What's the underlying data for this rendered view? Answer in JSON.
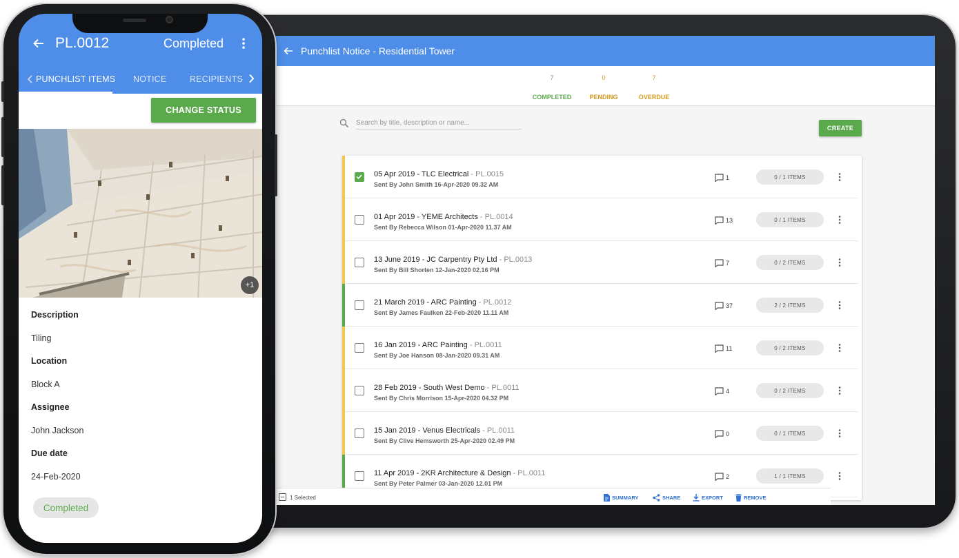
{
  "tablet": {
    "title": "Punchlist Notice - Residential Tower",
    "stats": [
      {
        "count": "7",
        "label": "COMPLETED"
      },
      {
        "count": "0",
        "label": "PENDING"
      },
      {
        "count": "7",
        "label": "OVERDUE"
      }
    ],
    "search_placeholder": "Search by title, description or name...",
    "create_label": "CREATE",
    "rows": [
      {
        "title": "05 Apr 2019 - TLC Electrical",
        "code": " - PL.0015",
        "sent": "Sent By John Smith 16-Apr-2020 09.32 AM",
        "comments": "1",
        "items": "0 / 1 ITEMS",
        "status_color": "#f2c94c",
        "checked": true
      },
      {
        "title": "01 Apr 2019 - YEME Architects",
        "code": " - PL.0014",
        "sent": "Sent By Rebecca Wilson 01-Apr-2020 11.37 AM",
        "comments": "13",
        "items": "0 / 1 ITEMS",
        "status_color": "#f2c94c",
        "checked": false
      },
      {
        "title": "13 June 2019 - JC Carpentry Pty Ltd",
        "code": " - PL.0013",
        "sent": "Sent By Bill Shorten 12-Jan-2020 02.16 PM",
        "comments": "7",
        "items": "0 / 2 ITEMS",
        "status_color": "#f2c94c",
        "checked": false
      },
      {
        "title": "21 March 2019 - ARC Painting",
        "code": " - PL.0012",
        "sent": "Sent By James Faulken 22-Feb-2020 11.11 AM",
        "comments": "37",
        "items": "2 / 2 ITEMS",
        "status_color": "#5aaa4b",
        "checked": false
      },
      {
        "title": "16 Jan 2019 - ARC Painting",
        "code": " - PL.0011",
        "sent": "Sent By Joe Hanson 08-Jan-2020 09.31 AM",
        "comments": "11",
        "items": "0 / 2 ITEMS",
        "status_color": "#f2c94c",
        "checked": false
      },
      {
        "title": "28 Feb 2019 - South West Demo",
        "code": " - PL.0011",
        "sent": "Sent By Chris Morrison 15-Apr-2020 04.32 PM",
        "comments": "4",
        "items": "0 / 2 ITEMS",
        "status_color": "#f2c94c",
        "checked": false
      },
      {
        "title": "15 Jan 2019 - Venus Electricals",
        "code": " - PL.0011",
        "sent": "Sent By Clive Hemsworth 25-Apr-2020 02.49 PM",
        "comments": "0",
        "items": "0 / 1 ITEMS",
        "status_color": "#f2c94c",
        "checked": false
      },
      {
        "title": "11 Apr 2019 - 2KR Architecture & Design",
        "code": " - PL.0011",
        "sent": "Sent By Peter Palmer 03-Jan-2020 12.01 PM",
        "comments": "2",
        "items": "1 / 1 ITEMS",
        "status_color": "#5aaa4b",
        "checked": false
      }
    ],
    "bottom": {
      "selected": "1 Selected",
      "summary": "SUMMARY",
      "share": "SHARE",
      "export": "EXPORT",
      "remove": "REMOVE"
    }
  },
  "phone": {
    "title": "PL.0012",
    "status": "Completed",
    "tabs": [
      "PUNCHLIST ITEMS",
      "NOTICE",
      "RECIPIENTS"
    ],
    "change_status_label": "CHANGE STATUS",
    "photo_more": "+1",
    "fields": [
      {
        "label": "Description",
        "value": "Tiling"
      },
      {
        "label": "Location",
        "value": "Block A"
      },
      {
        "label": "Assignee",
        "value": "John Jackson"
      },
      {
        "label": "Due date",
        "value": "24-Feb-2020"
      }
    ],
    "status_chip": "Completed"
  },
  "colors": {
    "primary": "#4f8ee8",
    "success": "#5aaa4b",
    "warning": "#f2c94c",
    "link": "#2f6fd0"
  }
}
